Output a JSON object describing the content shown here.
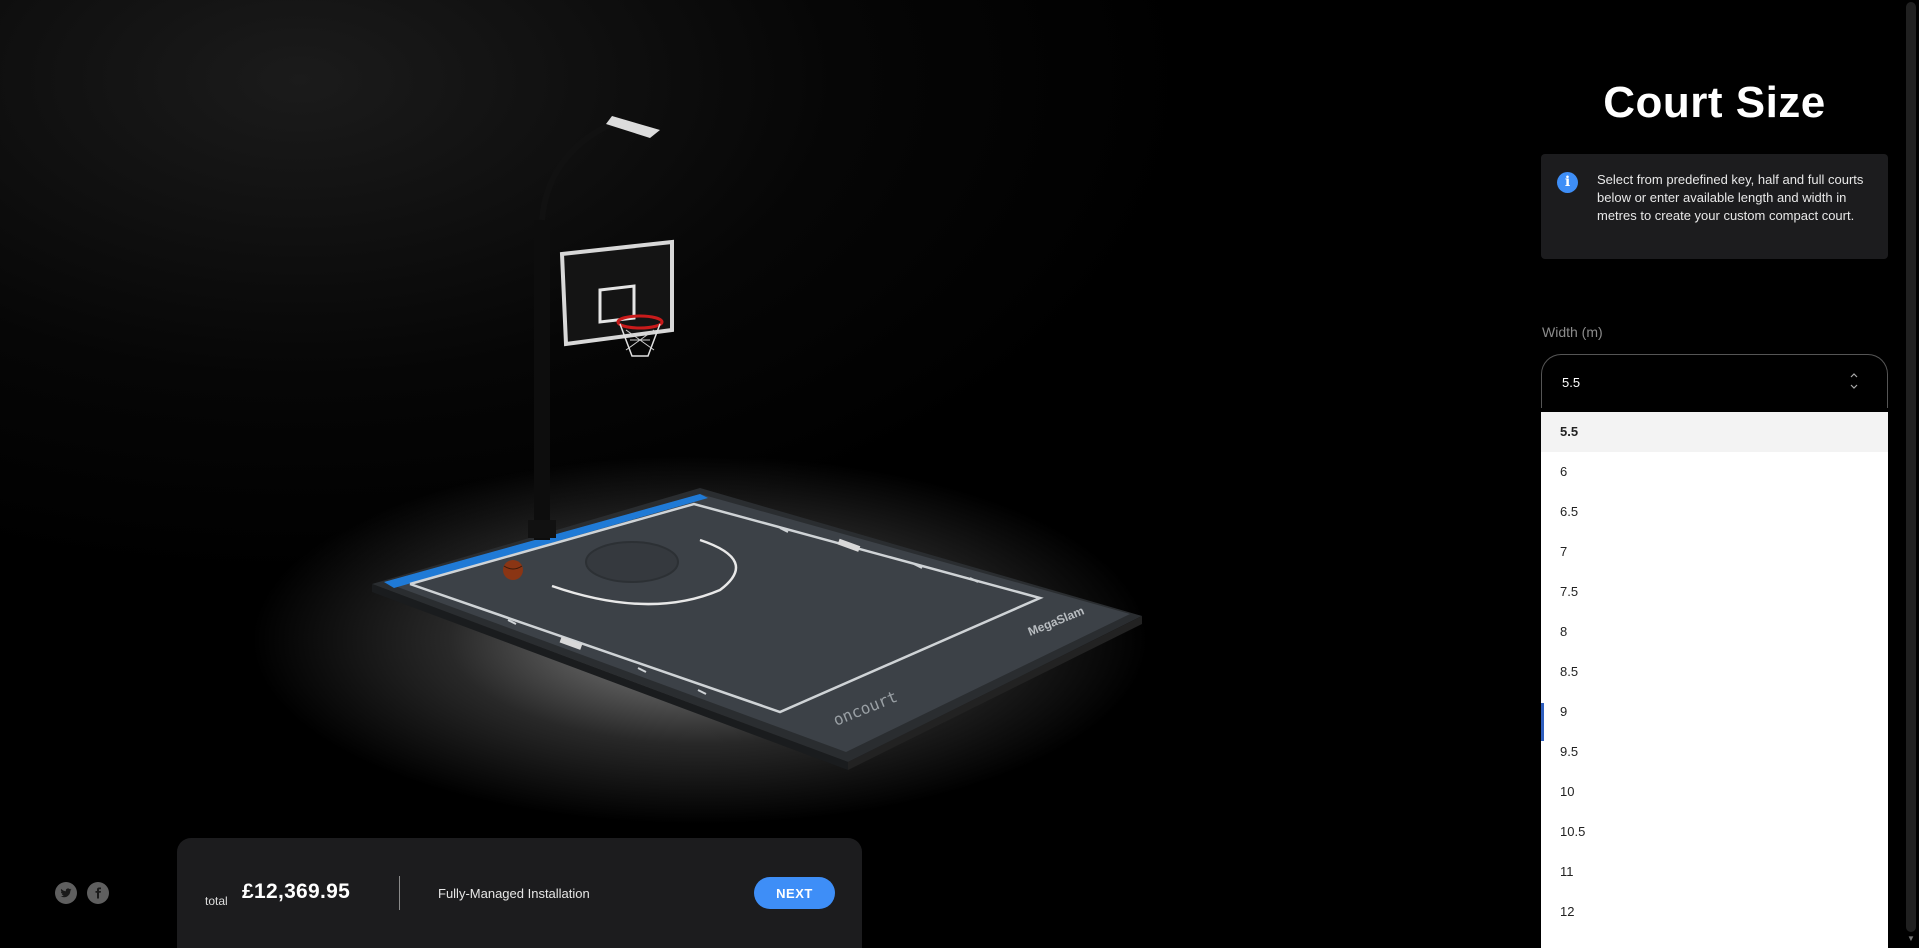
{
  "viewer": {
    "court_brand": "oncourt",
    "hoop_brand": "MegaSlam"
  },
  "social": {
    "twitter_icon": "twitter-icon",
    "facebook_icon": "facebook-icon"
  },
  "price_bar": {
    "total_label": "total",
    "total_value": "£12,369.95",
    "installation": "Fully-Managed Installation",
    "next_label": "NEXT"
  },
  "panel": {
    "title": "Court Size",
    "info_icon": "info-icon",
    "info_text": "Select from predefined key, half and full courts below or enter available length and width in metres to create your custom compact court.",
    "width_label": "Width (m)",
    "width_value": "5.5",
    "width_options": [
      "5.5",
      "6",
      "6.5",
      "7",
      "7.5",
      "8",
      "8.5",
      "9",
      "9.5",
      "10",
      "10.5",
      "11",
      "12"
    ]
  },
  "colors": {
    "accent": "#3e8ef7",
    "panel_bg": "#1c1c1e",
    "court": "#3c4146",
    "court_line": "#1f7ad6"
  }
}
